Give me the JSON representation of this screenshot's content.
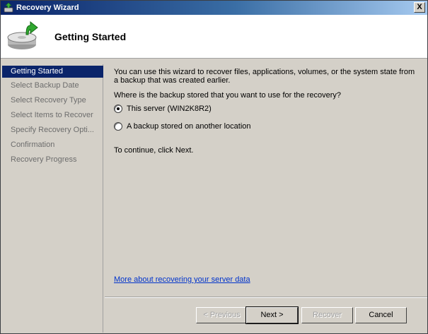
{
  "window": {
    "title": "Recovery Wizard",
    "close_glyph": "X"
  },
  "header": {
    "title": "Getting Started",
    "icon": "disk-recovery-icon"
  },
  "nav": {
    "items": [
      {
        "label": "Getting Started",
        "active": true
      },
      {
        "label": "Select Backup Date",
        "active": false
      },
      {
        "label": "Select Recovery Type",
        "active": false
      },
      {
        "label": "Select Items to Recover",
        "active": false
      },
      {
        "label": "Specify Recovery Opti...",
        "active": false
      },
      {
        "label": "Confirmation",
        "active": false
      },
      {
        "label": "Recovery Progress",
        "active": false
      }
    ]
  },
  "content": {
    "intro": "You can use this wizard to recover files, applications, volumes, or the system state from a backup that was created earlier.",
    "question": "Where is the backup stored that you want to use for the recovery?",
    "options": [
      {
        "label": "This server (WIN2K8R2)",
        "checked": true
      },
      {
        "label": "A backup stored on another location",
        "checked": false
      }
    ],
    "continue_text": "To continue, click Next.",
    "more_link": "More about recovering your server data"
  },
  "buttons": {
    "previous": "< Previous",
    "next": "Next >",
    "recover": "Recover",
    "cancel": "Cancel"
  },
  "colors": {
    "title_bar": "#0a246a",
    "selection": "#0a246a",
    "link": "#0033cc",
    "face": "#d4d0c8"
  }
}
